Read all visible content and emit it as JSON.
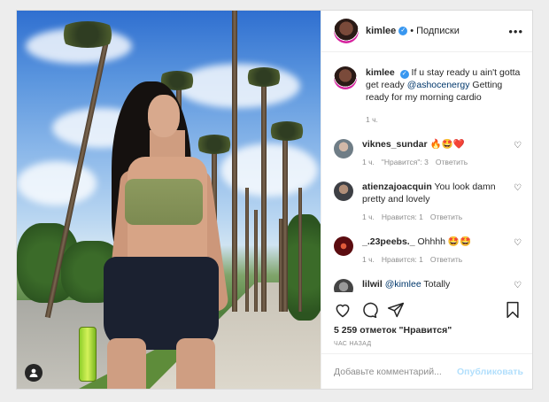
{
  "post": {
    "username": "kimlee",
    "follow_label": "Подписки",
    "dot": "•",
    "more_icon": "more-horizontal-icon",
    "caption": {
      "username": "kimlee",
      "text_before": "If u stay ready u ain't gotta get ready ",
      "mention": "@ashocenergy",
      "text_after": " Getting ready for my morning cardio",
      "time": "1 ч."
    },
    "comments": [
      {
        "username": "viknes_sundar",
        "text": "🔥🤩❤️",
        "time": "1 ч.",
        "likes": "\"Нравится\": 3",
        "reply": "Ответить",
        "avatar_color": "#6f7d86"
      },
      {
        "username": "atienzajoacquin",
        "text": "You look damn pretty and lovely",
        "time": "1 ч.",
        "likes": "Нравится: 1",
        "reply": "Ответить",
        "avatar_color": "#3d3f44"
      },
      {
        "username": "_.23peebs._",
        "text": "Ohhhh 🤩🤩",
        "time": "1 ч.",
        "likes": "Нравится: 1",
        "reply": "Ответить",
        "avatar_color": "#5b0c10"
      },
      {
        "username": "lilwil",
        "text_prefix": "",
        "mention": "@kimlee",
        "text": " Totally",
        "time": "",
        "likes": "",
        "reply": "",
        "avatar_color": "#444444"
      }
    ],
    "likes_text": "5 259 отметок \"Нравится\"",
    "time_ago": "час назад",
    "comment_placeholder": "Добавьте комментарий...",
    "publish_label": "Опубликовать"
  },
  "colors": {
    "accent": "#3897f0",
    "publish_disabled": "#b2dffc",
    "muted": "#8e8e8e"
  }
}
